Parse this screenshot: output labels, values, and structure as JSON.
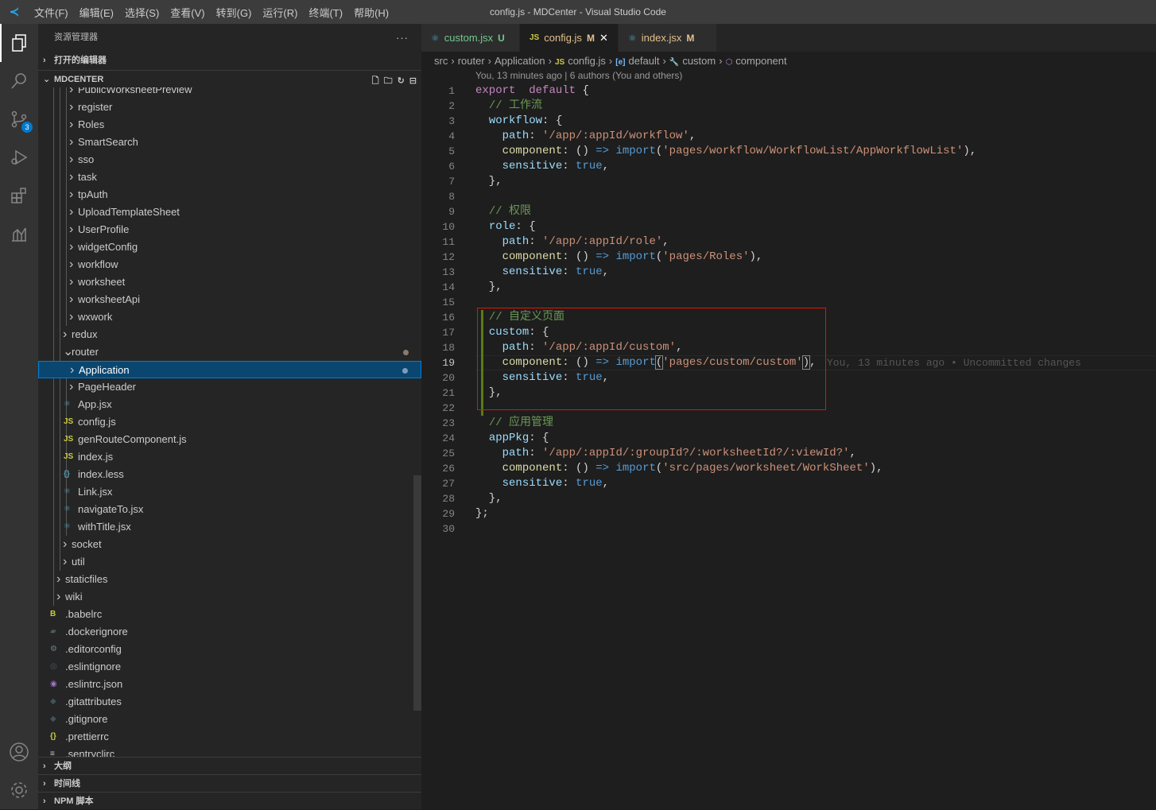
{
  "window": {
    "title": "config.js - MDCenter - Visual Studio Code",
    "menu": [
      "文件(F)",
      "编辑(E)",
      "选择(S)",
      "查看(V)",
      "转到(G)",
      "运行(R)",
      "终端(T)",
      "帮助(H)"
    ]
  },
  "activity": {
    "items": [
      "explorer-icon",
      "search-icon",
      "source-control-icon",
      "run-debug-icon",
      "extensions-icon",
      "analytics-icon"
    ],
    "scm_badge": "3",
    "bottom": [
      "account-icon",
      "settings-gear-icon"
    ]
  },
  "sidebar": {
    "title": "资源管理器",
    "more": "···",
    "open_editors": "打开的编辑器",
    "project": "MDCENTER",
    "tree": [
      {
        "label": "PublicWorksheetPreview",
        "type": "folder",
        "level": 3
      },
      {
        "label": "register",
        "type": "folder",
        "level": 3
      },
      {
        "label": "Roles",
        "type": "folder",
        "level": 3
      },
      {
        "label": "SmartSearch",
        "type": "folder",
        "level": 3
      },
      {
        "label": "sso",
        "type": "folder",
        "level": 3
      },
      {
        "label": "task",
        "type": "folder",
        "level": 3
      },
      {
        "label": "tpAuth",
        "type": "folder",
        "level": 3
      },
      {
        "label": "UploadTemplateSheet",
        "type": "folder",
        "level": 3
      },
      {
        "label": "UserProfile",
        "type": "folder",
        "level": 3
      },
      {
        "label": "widgetConfig",
        "type": "folder",
        "level": 3
      },
      {
        "label": "workflow",
        "type": "folder",
        "level": 3
      },
      {
        "label": "worksheet",
        "type": "folder",
        "level": 3
      },
      {
        "label": "worksheetApi",
        "type": "folder",
        "level": 3
      },
      {
        "label": "wxwork",
        "type": "folder",
        "level": 3
      },
      {
        "label": "redux",
        "type": "folder",
        "level": 2
      },
      {
        "label": "router",
        "type": "folder-open",
        "level": 2,
        "modified": true
      },
      {
        "label": "Application",
        "type": "folder",
        "level": 3,
        "selected": true,
        "modified": true
      },
      {
        "label": "PageHeader",
        "type": "folder",
        "level": 3
      },
      {
        "label": "App.jsx",
        "type": "react",
        "level": 3
      },
      {
        "label": "config.js",
        "type": "js",
        "level": 3
      },
      {
        "label": "genRouteComponent.js",
        "type": "js",
        "level": 3
      },
      {
        "label": "index.js",
        "type": "js",
        "level": 3
      },
      {
        "label": "index.less",
        "type": "less",
        "level": 3
      },
      {
        "label": "Link.jsx",
        "type": "react",
        "level": 3
      },
      {
        "label": "navigateTo.jsx",
        "type": "react",
        "level": 3
      },
      {
        "label": "withTitle.jsx",
        "type": "react",
        "level": 3
      },
      {
        "label": "socket",
        "type": "folder",
        "level": 2
      },
      {
        "label": "util",
        "type": "folder",
        "level": 2
      },
      {
        "label": "staticfiles",
        "type": "folder",
        "level": 1
      },
      {
        "label": "wiki",
        "type": "folder",
        "level": 1
      },
      {
        "label": ".babelrc",
        "type": "babel",
        "level": 0
      },
      {
        "label": ".dockerignore",
        "type": "docker",
        "level": 0
      },
      {
        "label": ".editorconfig",
        "type": "gear",
        "level": 0
      },
      {
        "label": ".eslintignore",
        "type": "eslint-gray",
        "level": 0
      },
      {
        "label": ".eslintrc.json",
        "type": "eslint",
        "level": 0
      },
      {
        "label": ".gitattributes",
        "type": "git",
        "level": 0
      },
      {
        "label": ".gitignore",
        "type": "git",
        "level": 0
      },
      {
        "label": ".prettierrc",
        "type": "braces",
        "level": 0
      },
      {
        "label": ".sentryclirc",
        "type": "lines",
        "level": 0
      }
    ],
    "sections": [
      "大纲",
      "时间线",
      "NPM 脚本"
    ]
  },
  "tabs": [
    {
      "label": "custom.jsx",
      "status": "U",
      "icon": "react-icon",
      "color": "#73c991"
    },
    {
      "label": "config.js",
      "status": "M",
      "icon": "js-icon",
      "color": "#e2c08d",
      "active": true,
      "close": "✕"
    },
    {
      "label": "index.jsx",
      "status": "M",
      "icon": "react-icon",
      "color": "#e2c08d"
    }
  ],
  "breadcrumbs": [
    "src",
    "router",
    "Application",
    "config.js",
    "default",
    "custom",
    "component"
  ],
  "codelens": "You, 13 minutes ago | 6 authors (You and others)",
  "current_line": 19,
  "blame": "You, 13 minutes ago • Uncommitted changes",
  "code": [
    [
      [
        "kw",
        "export"
      ],
      [
        "",
        "  "
      ],
      [
        "kw",
        "default"
      ],
      [
        "",
        " {"
      ]
    ],
    [
      [
        "",
        "  "
      ],
      [
        "cm",
        "// 工作流"
      ]
    ],
    [
      [
        "",
        "  "
      ],
      [
        "pr",
        "workflow"
      ],
      [
        "",
        ": {"
      ]
    ],
    [
      [
        "",
        "    "
      ],
      [
        "pr",
        "path"
      ],
      [
        "",
        ": "
      ],
      [
        "st",
        "'/app/:appId/workflow'"
      ],
      [
        "",
        ","
      ]
    ],
    [
      [
        "",
        "    "
      ],
      [
        "fn",
        "component"
      ],
      [
        "",
        ": () "
      ],
      [
        "bl",
        "=>"
      ],
      [
        "",
        ""
      ],
      [
        "bl",
        " import"
      ],
      [
        "",
        "("
      ],
      [
        "st",
        "'pages/workflow/WorkflowList/AppWorkflowList'"
      ],
      [
        "",
        "),"
      ]
    ],
    [
      [
        "",
        "    "
      ],
      [
        "pr",
        "sensitive"
      ],
      [
        "",
        ": "
      ],
      [
        "bl",
        "true"
      ],
      [
        "",
        ","
      ]
    ],
    [
      [
        "",
        "  },"
      ]
    ],
    [
      [
        "",
        ""
      ]
    ],
    [
      [
        "",
        "  "
      ],
      [
        "cm",
        "// 权限"
      ]
    ],
    [
      [
        "",
        "  "
      ],
      [
        "pr",
        "role"
      ],
      [
        "",
        ": {"
      ]
    ],
    [
      [
        "",
        "    "
      ],
      [
        "pr",
        "path"
      ],
      [
        "",
        ": "
      ],
      [
        "st",
        "'/app/:appId/role'"
      ],
      [
        "",
        ","
      ]
    ],
    [
      [
        "",
        "    "
      ],
      [
        "fn",
        "component"
      ],
      [
        "",
        ": () "
      ],
      [
        "bl",
        "=>"
      ],
      [
        "bl",
        " import"
      ],
      [
        "",
        "("
      ],
      [
        "st",
        "'pages/Roles'"
      ],
      [
        "",
        "),"
      ]
    ],
    [
      [
        "",
        "    "
      ],
      [
        "pr",
        "sensitive"
      ],
      [
        "",
        ": "
      ],
      [
        "bl",
        "true"
      ],
      [
        "",
        ","
      ]
    ],
    [
      [
        "",
        "  },"
      ]
    ],
    [
      [
        "",
        ""
      ]
    ],
    [
      [
        "",
        "  "
      ],
      [
        "cm",
        "// 自定义页面"
      ]
    ],
    [
      [
        "",
        "  "
      ],
      [
        "pr",
        "custom"
      ],
      [
        "",
        ": {"
      ]
    ],
    [
      [
        "",
        "    "
      ],
      [
        "pr",
        "path"
      ],
      [
        "",
        ": "
      ],
      [
        "st",
        "'/app/:appId/custom'"
      ],
      [
        "",
        ","
      ]
    ],
    [
      [
        "",
        "    "
      ],
      [
        "fn",
        "component"
      ],
      [
        "",
        ": () "
      ],
      [
        "bl",
        "=>"
      ],
      [
        "bl",
        " import"
      ],
      [
        "bm",
        "("
      ],
      [
        "st",
        "'pages/custom/custom'"
      ],
      [
        "bm",
        ")"
      ],
      [
        "",
        ","
      ]
    ],
    [
      [
        "",
        "    "
      ],
      [
        "pr",
        "sensitive"
      ],
      [
        "",
        ": "
      ],
      [
        "bl",
        "true"
      ],
      [
        "",
        ","
      ]
    ],
    [
      [
        "",
        "  },"
      ]
    ],
    [
      [
        "",
        ""
      ]
    ],
    [
      [
        "",
        "  "
      ],
      [
        "cm",
        "// 应用管理"
      ]
    ],
    [
      [
        "",
        "  "
      ],
      [
        "pr",
        "appPkg"
      ],
      [
        "",
        ": {"
      ]
    ],
    [
      [
        "",
        "    "
      ],
      [
        "pr",
        "path"
      ],
      [
        "",
        ": "
      ],
      [
        "st",
        "'/app/:appId/:groupId?/:worksheetId?/:viewId?'"
      ],
      [
        "",
        ","
      ]
    ],
    [
      [
        "",
        "    "
      ],
      [
        "fn",
        "component"
      ],
      [
        "",
        ": () "
      ],
      [
        "bl",
        "=>"
      ],
      [
        "bl",
        " import"
      ],
      [
        "",
        "("
      ],
      [
        "st",
        "'src/pages/worksheet/WorkSheet'"
      ],
      [
        "",
        "),"
      ]
    ],
    [
      [
        "",
        "    "
      ],
      [
        "pr",
        "sensitive"
      ],
      [
        "",
        ": "
      ],
      [
        "bl",
        "true"
      ],
      [
        "",
        ","
      ]
    ],
    [
      [
        "",
        "  },"
      ]
    ],
    [
      [
        "",
        "};"
      ]
    ],
    [
      [
        "",
        ""
      ]
    ]
  ]
}
